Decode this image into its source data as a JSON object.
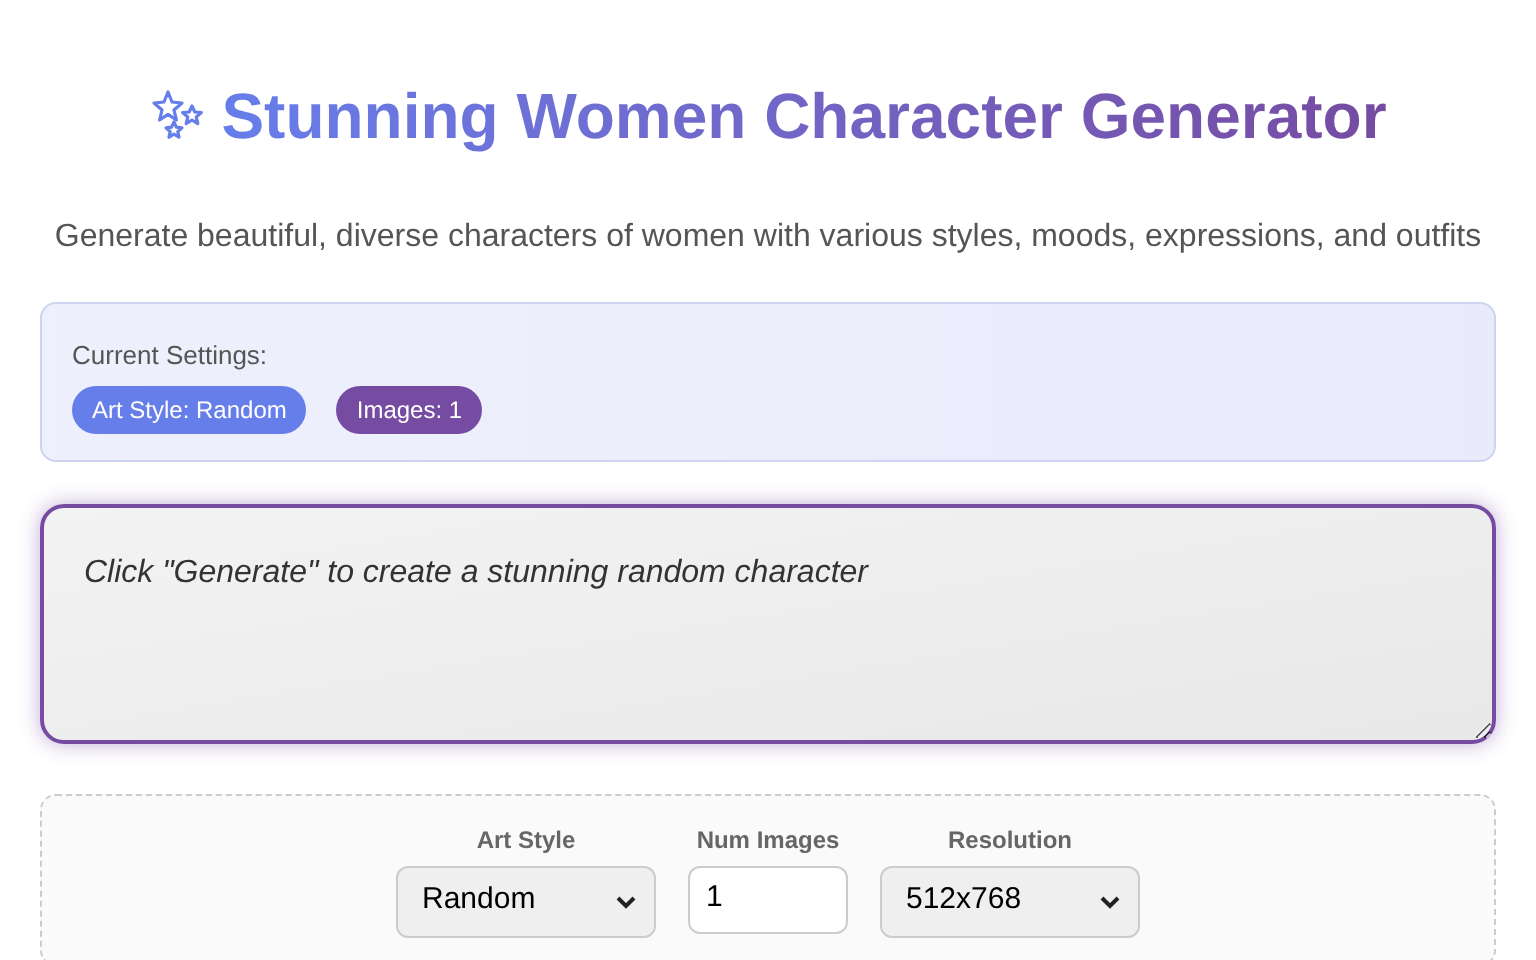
{
  "title": "Stunning Women Character Generator",
  "subtitle": "Generate beautiful, diverse characters of women with various styles, moods, expressions, and outfits",
  "settings": {
    "label": "Current Settings:",
    "badges": [
      {
        "text": "Art Style: Random",
        "color": "#667eea"
      },
      {
        "text": "Images: 1",
        "color": "#764ba2"
      }
    ]
  },
  "prompt": {
    "placeholder": "Click \"Generate\" to create a stunning random character"
  },
  "controls": [
    {
      "kind": "select",
      "label": "Art Style",
      "value": "Random"
    },
    {
      "kind": "number",
      "label": "Num Images",
      "value": "1"
    },
    {
      "kind": "select",
      "label": "Resolution",
      "value": "512x768"
    }
  ]
}
